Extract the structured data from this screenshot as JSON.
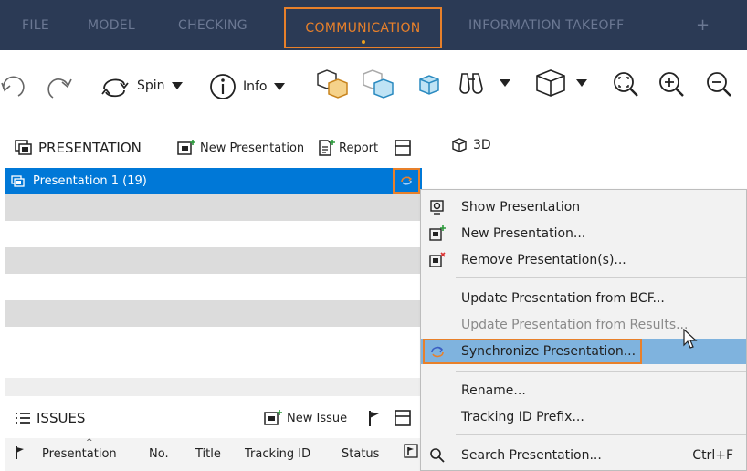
{
  "tabs": [
    {
      "label": "FILE"
    },
    {
      "label": "MODEL"
    },
    {
      "label": "CHECKING"
    },
    {
      "label": "COMMUNICATION",
      "active": true
    },
    {
      "label": "INFORMATION TAKEOFF"
    },
    {
      "label": "+"
    }
  ],
  "toolbar": {
    "spin_label": "Spin",
    "info_label": "Info"
  },
  "presentation": {
    "title": "PRESENTATION",
    "new_label": "New Presentation",
    "report_label": "Report",
    "items": [
      {
        "label": "Presentation 1 (19)"
      }
    ]
  },
  "view3d": {
    "label": "3D"
  },
  "issues": {
    "title": "ISSUES",
    "new_issue_label": "New Issue",
    "columns": [
      "Presentation",
      "No.",
      "Title",
      "Tracking ID",
      "Status"
    ]
  },
  "context_menu": {
    "items": [
      {
        "label": "Show Presentation"
      },
      {
        "label": "New Presentation..."
      },
      {
        "label": "Remove Presentation(s)..."
      },
      {
        "label": "Update Presentation from BCF..."
      },
      {
        "label": "Update Presentation from Results..."
      },
      {
        "label": "Synchronize Presentation..."
      },
      {
        "label": "Rename..."
      },
      {
        "label": "Tracking ID Prefix..."
      },
      {
        "label": "Search Presentation...",
        "shortcut": "Ctrl+F"
      }
    ]
  },
  "colors": {
    "tabbar_bg": "#2b3a55",
    "accent_orange": "#e8802a",
    "selection_blue": "#0078d7",
    "menu_highlight": "#7fb3de"
  }
}
